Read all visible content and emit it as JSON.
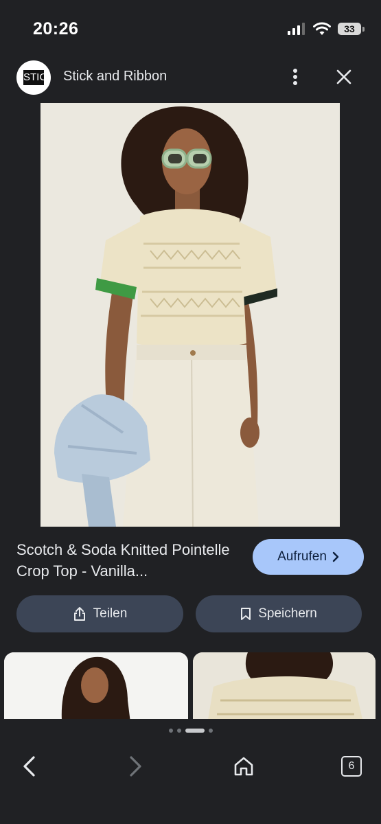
{
  "status_bar": {
    "time": "20:26",
    "battery": "33"
  },
  "header": {
    "site_logo_text": "STIC",
    "site_name": "Stick and Ribbon"
  },
  "product": {
    "title": "Scotch & Soda Knitted Pointelle Crop Top - Vanilla..."
  },
  "buttons": {
    "visit": "Aufrufen",
    "share": "Teilen",
    "save": "Speichern"
  },
  "nav": {
    "tabs_count": "6"
  },
  "icons": {
    "menu": "more-vert-icon",
    "close": "close-icon",
    "visit": "chevron-right-icon",
    "share": "share-icon",
    "save": "bookmark-icon",
    "back": "back-arrow-icon",
    "forward": "forward-arrow-icon",
    "home": "home-icon",
    "tabs": "tabs-icon"
  },
  "colors": {
    "background": "#202124",
    "accent": "#a8c7fa",
    "pill": "#3c4556"
  }
}
